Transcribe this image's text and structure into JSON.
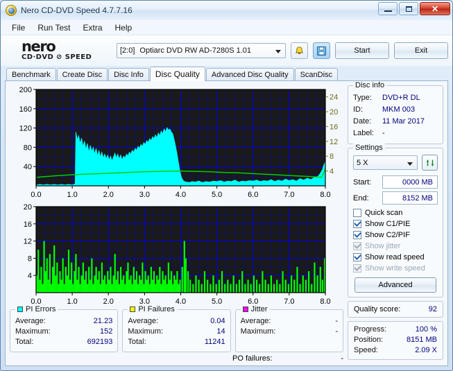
{
  "window": {
    "title": "Nero CD-DVD Speed 4.7.7.16",
    "app_icon": "nero-disc-icon",
    "controls": {
      "minimize": "minimize-icon",
      "maximize": "maximize-icon",
      "close": "✕"
    }
  },
  "menu": {
    "items": [
      "File",
      "Run Test",
      "Extra",
      "Help"
    ]
  },
  "toolbar": {
    "logo_main": "nero",
    "logo_sub": "CD·DVD ⊘ SPEED",
    "drive_index": "[2:0]",
    "drive_name": "Optiarc DVD RW AD-7280S 1.01",
    "icon_buttons": [
      "bell-icon",
      "save-icon"
    ],
    "start_label": "Start",
    "exit_label": "Exit"
  },
  "tabs": {
    "items": [
      "Benchmark",
      "Create Disc",
      "Disc Info",
      "Disc Quality",
      "Advanced Disc Quality",
      "ScanDisc"
    ],
    "selected": "Disc Quality"
  },
  "disc_info": {
    "legend": "Disc info",
    "rows": [
      {
        "key": "Type:",
        "value": "DVD+R DL"
      },
      {
        "key": "ID:",
        "value": "MKM 003"
      },
      {
        "key": "Date:",
        "value": "11 Mar 2017"
      },
      {
        "key": "Label:",
        "value": "-"
      }
    ]
  },
  "settings": {
    "legend": "Settings",
    "speed": "5 X",
    "refresh_icon": "refresh-icon",
    "start_label": "Start:",
    "start_value": "0000 MB",
    "end_label": "End:",
    "end_value": "8152 MB",
    "checkboxes": [
      {
        "label": "Quick scan",
        "checked": false,
        "disabled": false
      },
      {
        "label": "Show C1/PIE",
        "checked": true,
        "disabled": false
      },
      {
        "label": "Show C2/PIF",
        "checked": true,
        "disabled": false
      },
      {
        "label": "Show jitter",
        "checked": true,
        "disabled": true
      },
      {
        "label": "Show read speed",
        "checked": true,
        "disabled": false
      },
      {
        "label": "Show write speed",
        "checked": true,
        "disabled": true
      }
    ],
    "advanced_label": "Advanced"
  },
  "quality": {
    "label": "Quality score:",
    "value": "92"
  },
  "progress": {
    "rows": [
      {
        "key": "Progress:",
        "value": "100 %"
      },
      {
        "key": "Position:",
        "value": "8151 MB"
      },
      {
        "key": "Speed:",
        "value": "2.09 X"
      }
    ]
  },
  "stats": [
    {
      "legend": "PI Errors",
      "color": "#00ffff",
      "rows": [
        {
          "key": "Average:",
          "value": "21.23"
        },
        {
          "key": "Maximum:",
          "value": "152"
        },
        {
          "key": "Total:",
          "value": "692193"
        }
      ]
    },
    {
      "legend": "PI Failures",
      "color": "#ffff00",
      "rows": [
        {
          "key": "Average:",
          "value": "0.04"
        },
        {
          "key": "Maximum:",
          "value": "14"
        },
        {
          "key": "Total:",
          "value": "11241"
        }
      ]
    },
    {
      "legend": "Jitter",
      "color": "#ff00ff",
      "rows": [
        {
          "key": "Average:",
          "value": "-"
        },
        {
          "key": "Maximum:",
          "value": "-"
        }
      ],
      "extra": {
        "key": "PO failures:",
        "value": "-"
      }
    }
  ],
  "chart_data": [
    {
      "id": "pie_chart",
      "type": "area",
      "title": "PI Errors / read speed vs disc position",
      "xlabel": "",
      "ylabel": "PI Errors",
      "xlim": [
        0,
        8
      ],
      "ylim": [
        0,
        200
      ],
      "xticks": [
        "0.0",
        "1.0",
        "2.0",
        "3.0",
        "4.0",
        "5.0",
        "6.0",
        "7.0",
        "8.0"
      ],
      "yticks": [
        40,
        80,
        120,
        160,
        200
      ],
      "y2label": "Speed (X)",
      "y2lim": [
        0,
        26
      ],
      "y2ticks": [
        4,
        8,
        12,
        16,
        20,
        24
      ],
      "grid": true,
      "background": "#1a1a1a",
      "gridcolor": "#0000ff",
      "series": [
        {
          "name": "PI Errors",
          "color": "#00ffff",
          "x": [
            0.02,
            0.1,
            0.2,
            0.3,
            0.4,
            0.5,
            0.6,
            0.7,
            0.8,
            0.9,
            1.0,
            1.08,
            1.1,
            1.14,
            1.18,
            1.22,
            1.26,
            1.3,
            1.34,
            1.38,
            1.42,
            1.46,
            1.5,
            1.54,
            1.58,
            1.62,
            1.66,
            1.7,
            1.74,
            1.78,
            1.82,
            1.86,
            1.9,
            1.94,
            1.98,
            2.02,
            2.06,
            2.1,
            2.14,
            2.18,
            2.22,
            2.26,
            2.3,
            2.34,
            2.38,
            2.42,
            2.46,
            2.5,
            2.54,
            2.58,
            2.62,
            2.66,
            2.7,
            2.74,
            2.78,
            2.82,
            2.86,
            2.9,
            2.94,
            2.98,
            3.02,
            3.06,
            3.1,
            3.14,
            3.18,
            3.22,
            3.26,
            3.3,
            3.34,
            3.38,
            3.42,
            3.46,
            3.5,
            3.54,
            3.58,
            3.62,
            3.66,
            3.7,
            3.74,
            3.78,
            3.82,
            3.86,
            3.9,
            3.94,
            3.98,
            4.02,
            4.06,
            4.1,
            4.16,
            4.24,
            4.32,
            4.4,
            4.5,
            4.6,
            4.7,
            4.8,
            4.9,
            5.0,
            5.1,
            5.2,
            5.3,
            5.4,
            5.5,
            5.6,
            5.7,
            5.8,
            5.9,
            6.0,
            6.1,
            6.2,
            6.3,
            6.4,
            6.5,
            6.6,
            6.7,
            6.8,
            6.9,
            7.0,
            7.1,
            7.2,
            7.3,
            7.4,
            7.5,
            7.6,
            7.7,
            7.8,
            7.86,
            7.92,
            7.96,
            8.0
          ],
          "y": [
            2,
            3,
            2,
            3,
            2,
            3,
            2,
            3,
            2,
            3,
            2,
            4,
            112,
            96,
            104,
            88,
            99,
            82,
            93,
            76,
            88,
            70,
            84,
            72,
            80,
            66,
            78,
            62,
            74,
            60,
            70,
            58,
            66,
            56,
            64,
            54,
            62,
            52,
            60,
            68,
            58,
            66,
            56,
            64,
            54,
            62,
            58,
            66,
            62,
            70,
            66,
            74,
            70,
            78,
            74,
            82,
            78,
            86,
            82,
            90,
            86,
            94,
            90,
            98,
            94,
            102,
            98,
            106,
            100,
            110,
            104,
            114,
            108,
            118,
            112,
            121,
            116,
            118,
            112,
            108,
            96,
            82,
            66,
            48,
            30,
            18,
            12,
            9,
            8,
            7,
            9,
            8,
            10,
            7,
            9,
            8,
            10,
            9,
            11,
            8,
            10,
            9,
            12,
            8,
            10,
            9,
            11,
            10,
            12,
            9,
            11,
            10,
            13,
            9,
            12,
            10,
            14,
            11,
            13,
            10,
            15,
            12,
            16,
            13,
            18,
            20,
            26,
            34,
            44,
            50
          ]
        },
        {
          "name": "Read speed",
          "color": "#00d000",
          "type": "line",
          "axis": "right",
          "x": [
            0.02,
            0.5,
            1.0,
            1.5,
            2.0,
            2.5,
            3.0,
            3.5,
            4.0,
            4.4,
            4.8,
            5.2,
            5.6,
            6.0,
            6.4,
            6.8,
            7.2,
            7.6,
            7.9,
            8.0
          ],
          "y": [
            2.3,
            2.7,
            3.0,
            3.2,
            3.4,
            3.6,
            3.8,
            3.9,
            4.0,
            3.9,
            3.8,
            3.6,
            3.5,
            3.3,
            3.1,
            2.9,
            2.7,
            2.5,
            2.3,
            4.6
          ]
        }
      ]
    },
    {
      "id": "pif_chart",
      "type": "bar",
      "title": "PI Failures vs disc position",
      "xlabel": "",
      "ylabel": "PI Failures",
      "xlim": [
        0,
        8
      ],
      "ylim": [
        0,
        20
      ],
      "xticks": [
        "0.0",
        "1.0",
        "2.0",
        "3.0",
        "4.0",
        "5.0",
        "6.0",
        "7.0",
        "8.0"
      ],
      "yticks": [
        4,
        8,
        12,
        16,
        20
      ],
      "grid": true,
      "background": "#1a1a1a",
      "gridcolor": "#0000ff",
      "series": [
        {
          "name": "PI Failures",
          "color": "#00ff00",
          "x": [
            0.02,
            0.06,
            0.1,
            0.14,
            0.18,
            0.22,
            0.26,
            0.3,
            0.34,
            0.38,
            0.42,
            0.46,
            0.5,
            0.54,
            0.58,
            0.62,
            0.66,
            0.7,
            0.74,
            0.78,
            0.82,
            0.86,
            0.9,
            0.94,
            0.98,
            1.02,
            1.06,
            1.1,
            1.14,
            1.18,
            1.22,
            1.26,
            1.3,
            1.34,
            1.38,
            1.42,
            1.46,
            1.5,
            1.54,
            1.58,
            1.62,
            1.66,
            1.7,
            1.74,
            1.78,
            1.82,
            1.86,
            1.9,
            1.94,
            1.98,
            2.02,
            2.06,
            2.1,
            2.14,
            2.18,
            2.22,
            2.26,
            2.3,
            2.34,
            2.38,
            2.42,
            2.46,
            2.5,
            2.54,
            2.58,
            2.62,
            2.66,
            2.7,
            2.74,
            2.78,
            2.82,
            2.86,
            2.9,
            2.94,
            2.98,
            3.02,
            3.06,
            3.1,
            3.14,
            3.18,
            3.22,
            3.26,
            3.3,
            3.34,
            3.38,
            3.42,
            3.46,
            3.5,
            3.54,
            3.58,
            3.62,
            3.66,
            3.7,
            3.74,
            3.78,
            3.82,
            3.86,
            3.9,
            3.94,
            3.98,
            4.04,
            4.1,
            4.14,
            4.2,
            4.26,
            4.34,
            4.42,
            4.5,
            4.58,
            4.66,
            4.74,
            4.82,
            4.9,
            4.98,
            5.06,
            5.14,
            5.22,
            5.3,
            5.38,
            5.46,
            5.54,
            5.62,
            5.7,
            5.78,
            5.86,
            5.94,
            6.02,
            6.1,
            6.18,
            6.26,
            6.34,
            6.42,
            6.5,
            6.58,
            6.66,
            6.74,
            6.82,
            6.9,
            6.98,
            7.06,
            7.14,
            7.22,
            7.3,
            7.38,
            7.46,
            7.54,
            7.62,
            7.7,
            7.78,
            7.86,
            7.92,
            7.98
          ],
          "y": [
            4,
            10,
            3,
            6,
            2,
            12,
            5,
            8,
            3,
            9,
            2,
            6,
            11,
            4,
            7,
            2,
            5,
            3,
            8,
            2,
            6,
            4,
            10,
            3,
            7,
            2,
            5,
            9,
            3,
            6,
            2,
            4,
            7,
            3,
            5,
            2,
            6,
            3,
            8,
            2,
            4,
            6,
            3,
            5,
            2,
            7,
            3,
            4,
            2,
            5,
            3,
            6,
            2,
            4,
            9,
            3,
            5,
            2,
            6,
            3,
            4,
            2,
            5,
            7,
            3,
            4,
            2,
            6,
            3,
            5,
            2,
            4,
            3,
            7,
            2,
            5,
            3,
            4,
            2,
            6,
            3,
            5,
            2,
            4,
            3,
            6,
            2,
            5,
            3,
            4,
            2,
            7,
            3,
            5,
            2,
            4,
            3,
            5,
            2,
            3,
            6,
            12,
            8,
            5,
            3,
            2,
            4,
            3,
            2,
            5,
            3,
            2,
            4,
            2,
            3,
            5,
            2,
            3,
            2,
            4,
            2,
            3,
            5,
            2,
            3,
            2,
            4,
            3,
            2,
            5,
            3,
            2,
            4,
            2,
            3,
            2,
            5,
            3,
            2,
            4,
            3,
            6,
            2,
            4,
            3,
            5,
            2,
            7,
            4,
            6,
            3,
            8,
            5,
            11,
            7,
            9
          ]
        }
      ]
    }
  ]
}
